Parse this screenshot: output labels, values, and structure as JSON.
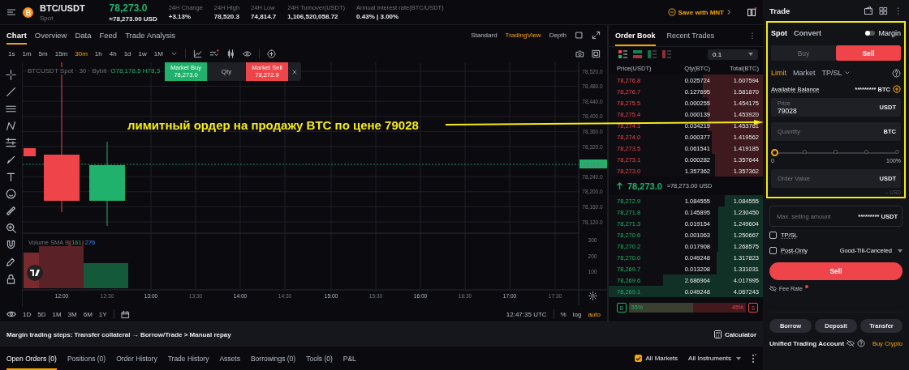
{
  "header": {
    "pair": "BTC/USDT",
    "market": "Spot",
    "price": "78,273.0",
    "price_usd": "≈78,273.00 USD",
    "stats": [
      {
        "label": "24H Change",
        "value": "+3.13%"
      },
      {
        "label": "24H High",
        "value": "78,520.3"
      },
      {
        "label": "24H Low",
        "value": "74,814.7"
      },
      {
        "label": "24H Turnover(USDT)",
        "value": "1,106,520,058.72"
      },
      {
        "label": "Annual interest rate(BTC/USDT)",
        "value": "0.43% | 3.00%"
      }
    ],
    "promo": "Save with MNT"
  },
  "chart_tabs": [
    {
      "label": "Chart",
      "selected": true
    },
    {
      "label": "Overview",
      "selected": false
    },
    {
      "label": "Data",
      "selected": false
    },
    {
      "label": "Feed",
      "selected": false
    },
    {
      "label": "Trade Analysis",
      "selected": false
    }
  ],
  "chart_views": [
    {
      "label": "Standard",
      "selected": false
    },
    {
      "label": "TradingView",
      "selected": true
    },
    {
      "label": "Depth",
      "selected": false
    }
  ],
  "intervals": [
    {
      "label": "1s",
      "selected": false
    },
    {
      "label": "1m",
      "selected": false
    },
    {
      "label": "5m",
      "selected": false
    },
    {
      "label": "15m",
      "selected": false
    },
    {
      "label": "30m",
      "selected": true
    },
    {
      "label": "1h",
      "selected": false
    },
    {
      "label": "4h",
      "selected": false
    },
    {
      "label": "1d",
      "selected": false
    },
    {
      "label": "1w",
      "selected": false
    },
    {
      "label": "1M",
      "selected": false
    }
  ],
  "chart": {
    "legend": "BTCUSDT Spot · 30 · Bybit",
    "ohlc": "O78,178.5  H78,3",
    "price_ticks": [
      "78,520.0",
      "78,480.0",
      "78,440.0",
      "78,400.0",
      "78,360.0",
      "78,320.0",
      "78,240.0",
      "78,200.0",
      "78,160.0",
      "78,120.0"
    ],
    "last_price": "78,273.0",
    "volume_legend": "Volume SMA 9",
    "volume_values": [
      "161",
      "276"
    ],
    "volume_ticks": [
      "300",
      "200",
      "100"
    ],
    "time_ticks": [
      "12:00",
      "12:30",
      "13:00",
      "13:30",
      "14:00",
      "14:30",
      "15:00",
      "15:30",
      "16:00",
      "16:30",
      "17:00",
      "17:30"
    ]
  },
  "quick_trade": {
    "buy_label": "Market Buy",
    "buy_price": "78,273.0",
    "qty": "Qty",
    "sell_label": "Market Sell",
    "sell_price": "78,272.9"
  },
  "ranges": [
    "1D",
    "5D",
    "1M",
    "3M",
    "6M",
    "1Y"
  ],
  "clock": "12:47:35 UTC",
  "scale_options": [
    {
      "label": "%",
      "selected": false
    },
    {
      "label": "log",
      "selected": false
    },
    {
      "label": "auto",
      "selected": true
    }
  ],
  "order_book": {
    "tabs": [
      {
        "label": "Order Book",
        "selected": true
      },
      {
        "label": "Recent Trades",
        "selected": false
      }
    ],
    "precision": "0.1",
    "columns": [
      "Price(USDT)",
      "Qty(BTC)",
      "Total(BTC)"
    ],
    "asks": [
      {
        "price": "78,276.8",
        "qty": "0.025724",
        "total": "1.607594",
        "level": 0.39
      },
      {
        "price": "78,276.7",
        "qty": "0.127695",
        "total": "1.581870",
        "level": 0.39
      },
      {
        "price": "78,275.5",
        "qty": "0.000255",
        "total": "1.454175",
        "level": 0.36
      },
      {
        "price": "78,275.4",
        "qty": "0.000139",
        "total": "1.453920",
        "level": 0.36
      },
      {
        "price": "78,274.1",
        "qty": "0.034219",
        "total": "1.453781",
        "level": 0.36
      },
      {
        "price": "78,274.0",
        "qty": "0.000377",
        "total": "1.419562",
        "level": 0.33
      },
      {
        "price": "78,273.5",
        "qty": "0.061541",
        "total": "1.419185",
        "level": 0.33
      },
      {
        "price": "78,273.1",
        "qty": "0.000282",
        "total": "1.357644",
        "level": 0.31
      },
      {
        "price": "78,273.0",
        "qty": "1.357362",
        "total": "1.357362",
        "level": 0.31
      }
    ],
    "last_price": "78,273.0",
    "last_price_usd": "≈78,273.00 USD",
    "bids": [
      {
        "price": "78,272.9",
        "qty": "1.084555",
        "total": "1.084555",
        "level": 0.25
      },
      {
        "price": "78,271.8",
        "qty": "0.145895",
        "total": "1.230450",
        "level": 0.29
      },
      {
        "price": "78,271.3",
        "qty": "0.019154",
        "total": "1.249604",
        "level": 0.29
      },
      {
        "price": "78,270.6",
        "qty": "0.001063",
        "total": "1.250667",
        "level": 0.29
      },
      {
        "price": "78,270.2",
        "qty": "0.017908",
        "total": "1.268575",
        "level": 0.29
      },
      {
        "price": "78,270.0",
        "qty": "0.049248",
        "total": "1.317823",
        "level": 0.3
      },
      {
        "price": "78,269.7",
        "qty": "0.013208",
        "total": "1.331031",
        "level": 0.3
      },
      {
        "price": "78,269.6",
        "qty": "2.686964",
        "total": "4.017995",
        "level": 0.65
      },
      {
        "price": "78,269.1",
        "qty": "0.049248",
        "total": "4.067243",
        "level": 1.0
      }
    ],
    "buy_ratio": {
      "tag": "B",
      "percent": "55%",
      "level": 0.55
    },
    "sell_ratio": {
      "percent": "45%",
      "tag": "S"
    }
  },
  "margin_steps": "Margin trading steps: Transfer collateral → Borrow/Trade > Manual repay",
  "calculator": "Calculator",
  "bottom_tabs": [
    {
      "label": "Open Orders (0)",
      "selected": true
    },
    {
      "label": "Positions (0)",
      "selected": false
    },
    {
      "label": "Order History",
      "selected": false
    },
    {
      "label": "Trade History",
      "selected": false
    },
    {
      "label": "Assets",
      "selected": false
    },
    {
      "label": "Borrowings (0)",
      "selected": false
    },
    {
      "label": "Tools (0)",
      "selected": false
    },
    {
      "label": "P&L",
      "selected": false
    }
  ],
  "all_markets": {
    "label": "All Markets",
    "checked": true
  },
  "instruments": "All Instruments",
  "trade": {
    "title": "Trade",
    "modes": [
      {
        "label": "Spot",
        "selected": true
      },
      {
        "label": "Convert",
        "selected": false
      }
    ],
    "margin": {
      "label": "Margin",
      "on": false
    },
    "sides": [
      {
        "label": "Buy",
        "selected": false
      },
      {
        "label": "Sell",
        "selected": true
      }
    ],
    "order_types": [
      {
        "label": "Limit",
        "selected": true
      },
      {
        "label": "Market",
        "selected": false
      },
      {
        "label": "TP/SL",
        "selected": false
      }
    ],
    "balance_label": "Available Balance",
    "balance": "********* BTC",
    "price_field": {
      "label": "Price",
      "value": "79028",
      "unit": "USDT"
    },
    "quantity_field": {
      "placeholder": "Quantity",
      "unit": "BTC"
    },
    "slider": {
      "level": 0,
      "min": "0",
      "max": "100%"
    },
    "order_value": {
      "placeholder": "Order Value",
      "unit": "USDT"
    },
    "order_value_usd": "-- USD",
    "max_amount": {
      "label": "Max. selling amount",
      "value": "********* USDT"
    },
    "options": [
      {
        "label": "TP/SL",
        "checked": false
      },
      {
        "label": "Post-Only",
        "checked": false
      }
    ],
    "time_in_force": "Good-Till-Canceled",
    "submit": "Sell",
    "fee_rate": "Fee Rate",
    "actions": [
      "Borrow",
      "Deposit",
      "Transfer"
    ],
    "account": "Unified Trading Account",
    "buy_crypto": "Buy Crypto"
  },
  "annotation": {
    "text": "лимитный ордер на продажу BTC по цене 79028"
  }
}
